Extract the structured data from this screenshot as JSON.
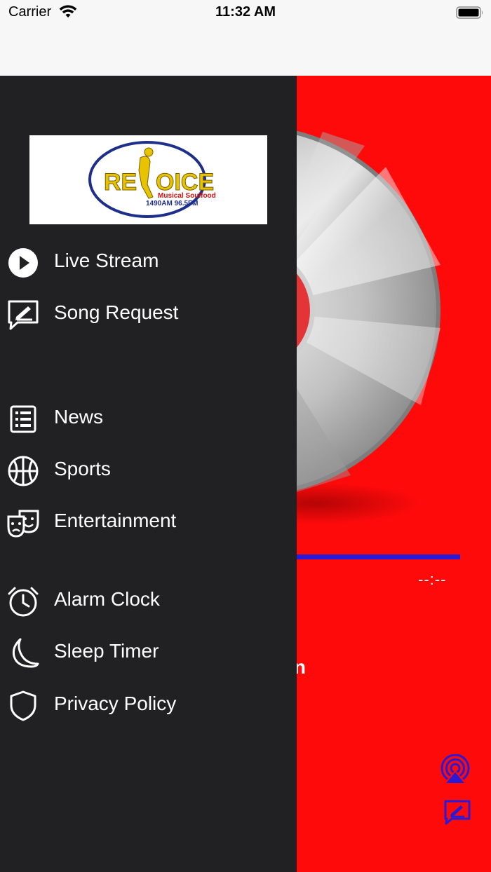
{
  "status_bar": {
    "carrier": "Carrier",
    "time": "11:32 AM"
  },
  "logo": {
    "brand_text": "RE OICE",
    "tagline": "Musical Soulfood",
    "frequencies": "1490AM 96.5FM",
    "accent_gold": "#e8c400",
    "accent_blue": "#1d2f8a"
  },
  "drawer": {
    "items": [
      {
        "label": "Live Stream",
        "icon": "play-circle-icon"
      },
      {
        "label": "Song Request",
        "icon": "compose-message-icon"
      },
      {
        "label": "News",
        "icon": "news-list-icon"
      },
      {
        "label": "Sports",
        "icon": "basketball-icon"
      },
      {
        "label": "Entertainment",
        "icon": "theater-masks-icon"
      },
      {
        "label": "Alarm Clock",
        "icon": "alarm-clock-icon"
      },
      {
        "label": "Sleep Timer",
        "icon": "moon-icon"
      },
      {
        "label": "Privacy Policy",
        "icon": "shield-icon"
      }
    ]
  },
  "player": {
    "time_display": "--:--",
    "title_fragment": "n",
    "background_color": "#fe0a0b",
    "progress_color": "#2a1ad6",
    "progress": 0
  },
  "colors": {
    "drawer_background": "#212022",
    "status_bar_background": "#f7f7f7"
  }
}
